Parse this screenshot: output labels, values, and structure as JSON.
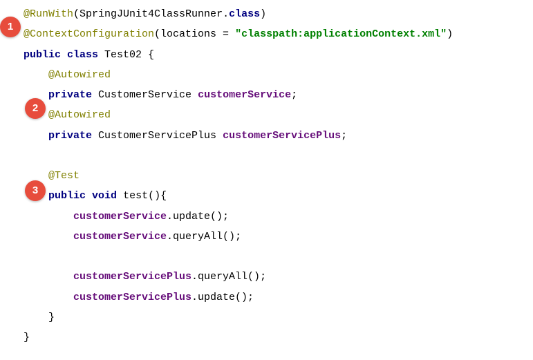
{
  "bubbles": {
    "n1": "1",
    "n2": "2",
    "n3": "3"
  },
  "code": {
    "runwith_ann": "@RunWith",
    "runwith_open": "(",
    "runwith_arg_type": "SpringJUnit4ClassRunner.",
    "class_kw": "class",
    "runwith_close": ")",
    "ctx_ann": "@ContextConfiguration",
    "ctx_args_prefix": "(locations = ",
    "ctx_string": "\"classpath:applicationContext.xml\"",
    "ctx_args_suffix": ")",
    "public_kw": "public",
    "class_kw2": "class",
    "class_name": " Test02 {",
    "autowired1": "@Autowired",
    "private_kw": "private",
    "cs_type": " CustomerService ",
    "cs_field": "customerService",
    "semi": ";",
    "autowired2": "@Autowired",
    "csp_type": " CustomerServicePlus ",
    "csp_field": "customerServicePlus",
    "test_ann": "@Test",
    "void_kw": "void",
    "test_sig": " test(){",
    "l1_obj": "customerService",
    "l1_call": ".update();",
    "l2_obj": "customerService",
    "l2_call": ".queryAll();",
    "l3_obj": "customerServicePlus",
    "l3_call": ".queryAll();",
    "l4_obj": "customerServicePlus",
    "l4_call": ".update();",
    "brace_close1": "    }",
    "brace_close2": "}"
  }
}
